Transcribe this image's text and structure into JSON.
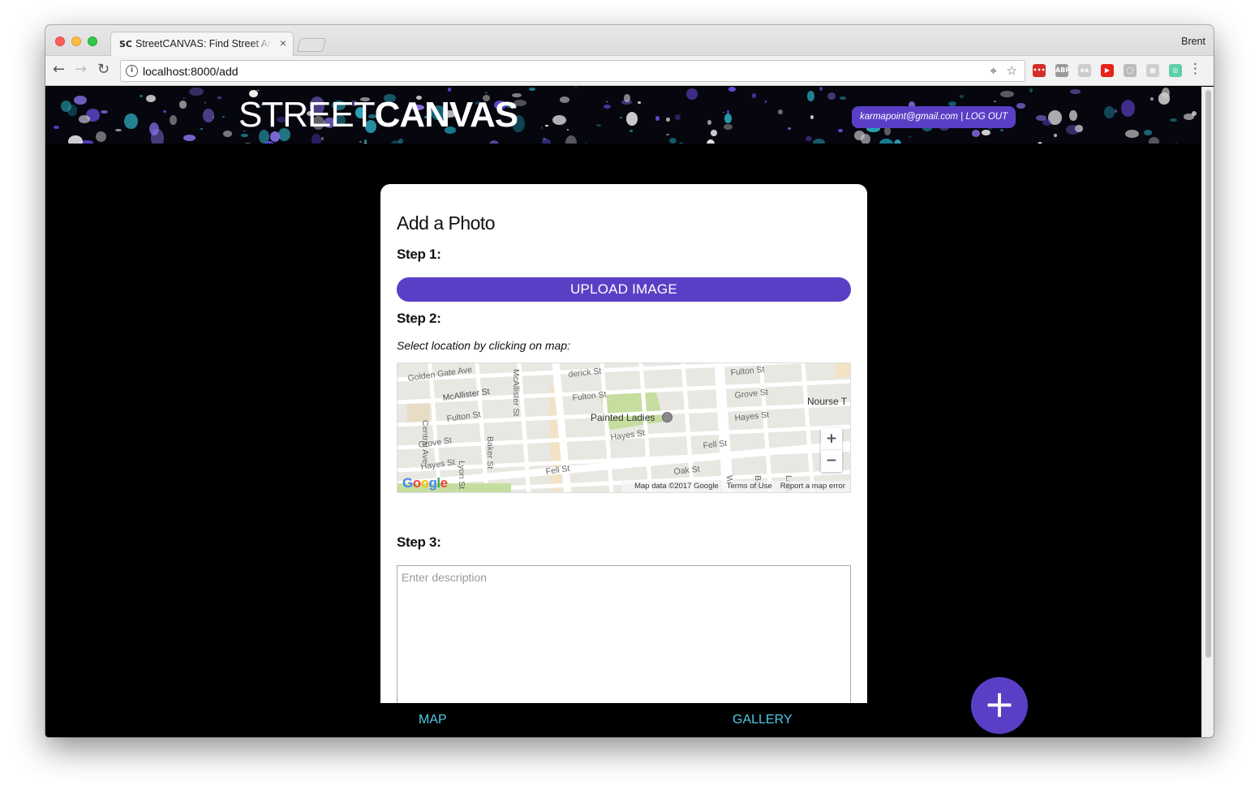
{
  "browser": {
    "tab_favicon": "SC",
    "tab_title": "StreetCANVAS: Find Street Art",
    "tab_close": "×",
    "profile_name": "Brent",
    "url_host": "localhost:8000/add",
    "back_icon": "←",
    "forward_icon": "→",
    "reload_icon": "↻",
    "menu_icon": "⋮",
    "target_icon": "⌖",
    "star_icon": "☆",
    "extensions": [
      {
        "name": "lastpass-extension-icon",
        "label": "•••",
        "color": "#d32d27"
      },
      {
        "name": "adblock-extension-icon",
        "label": "ABP",
        "color": "#9a9a9a"
      },
      {
        "name": "ex-extension-icon",
        "label": "ex",
        "color": "#cccccc"
      },
      {
        "name": "video-extension-icon",
        "label": "▶",
        "color": "#e62117"
      },
      {
        "name": "circle-extension-icon",
        "label": "◯",
        "color": "#bbbbbb"
      },
      {
        "name": "grid-extension-icon",
        "label": "▦",
        "color": "#cfcfcf"
      },
      {
        "name": "ring-extension-icon",
        "label": "◎",
        "color": "#5ecfa6"
      }
    ]
  },
  "header": {
    "logo_light": "STREET",
    "logo_bold": "CANVAS",
    "user_email": "karmapoint@gmail.com",
    "separator": " | ",
    "logout_label": "LOG OUT"
  },
  "form": {
    "title": "Add a Photo",
    "step1_label": "Step 1:",
    "upload_label": "UPLOAD IMAGE",
    "step2_label": "Step 2:",
    "step2_hint": "Select location by clicking on map:",
    "step3_label": "Step 3:",
    "description_placeholder": "Enter description"
  },
  "map": {
    "streets": [
      "Golden Gate Ave",
      "McAllister St",
      "derick St",
      "McAllister St",
      "Fulton St",
      "Central Ave",
      "McAllister St",
      "Fulton St",
      "Fulton St",
      "Grove St",
      "Baker St",
      "Grove St",
      "Lyon St",
      "Hayes St",
      "Hayes St",
      "Hayes St",
      "Fell St",
      "Fell St",
      "Oak St",
      "Nourse T",
      "W",
      "Buc",
      "Lagu"
    ],
    "landmark": "Painted Ladies",
    "zoom_in": "+",
    "zoom_out": "−",
    "google_letters": [
      "G",
      "o",
      "o",
      "g",
      "l",
      "e"
    ],
    "google_colors": [
      "#4285f4",
      "#ea4335",
      "#fbbc05",
      "#4285f4",
      "#34a853",
      "#ea4335"
    ],
    "footer": [
      "Map data ©2017 Google",
      "Terms of Use",
      "Report a map error"
    ]
  },
  "bottom_nav": {
    "map_label": "MAP",
    "gallery_label": "GALLERY",
    "add_label": "+"
  },
  "colors": {
    "accent": "#5a3fc6",
    "link": "#4fc8e8",
    "page_bg": "#000000"
  }
}
